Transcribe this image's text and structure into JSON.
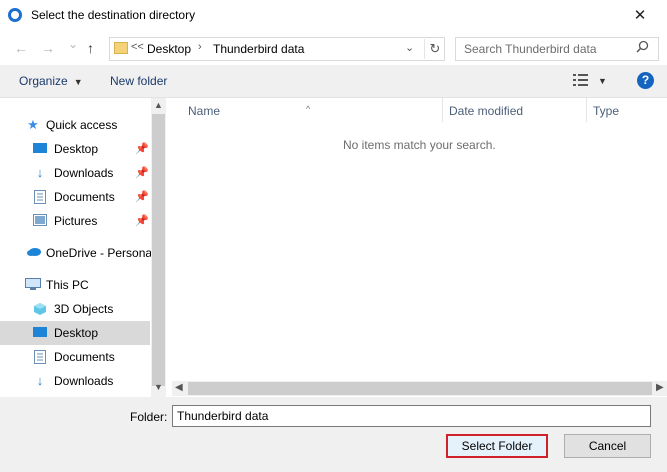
{
  "window": {
    "title": "Select the destination directory",
    "close_glyph": "✕"
  },
  "nav": {
    "back": "←",
    "forward": "→",
    "recent": "⌄",
    "up": "↑"
  },
  "address": {
    "overflow": "<<",
    "segments": [
      "Desktop",
      "Thunderbird data"
    ],
    "sep": "›",
    "dropdown": "⌄",
    "refresh": "↻"
  },
  "search": {
    "placeholder": "Search Thunderbird data"
  },
  "toolbar": {
    "organize": "Organize",
    "new_folder": "New folder"
  },
  "navpane": {
    "items": [
      {
        "label": "Quick access",
        "icon": "star-icon"
      },
      {
        "label": "Desktop",
        "icon": "desktop-icon",
        "pinned": true
      },
      {
        "label": "Downloads",
        "icon": "download-icon",
        "pinned": true
      },
      {
        "label": "Documents",
        "icon": "document-icon",
        "pinned": true
      },
      {
        "label": "Pictures",
        "icon": "picture-icon",
        "pinned": true
      },
      {
        "label": "OneDrive - Personal",
        "icon": "cloud-icon"
      },
      {
        "label": "This PC",
        "icon": "computer-icon"
      },
      {
        "label": "3D Objects",
        "icon": "cube-icon"
      },
      {
        "label": "Desktop",
        "icon": "desktop-icon",
        "selected": true
      },
      {
        "label": "Documents",
        "icon": "document-icon"
      },
      {
        "label": "Downloads",
        "icon": "download-icon"
      }
    ]
  },
  "columns": {
    "name": "Name",
    "date_modified": "Date modified",
    "type": "Type"
  },
  "empty_message": "No items match your search.",
  "folder": {
    "label": "Folder:",
    "value": "Thunderbird data"
  },
  "buttons": {
    "select": "Select Folder",
    "cancel": "Cancel"
  },
  "colors": {
    "accent": "#1565c0",
    "highlight_border": "#d0202a",
    "selected_row": "#d9d9d9"
  }
}
